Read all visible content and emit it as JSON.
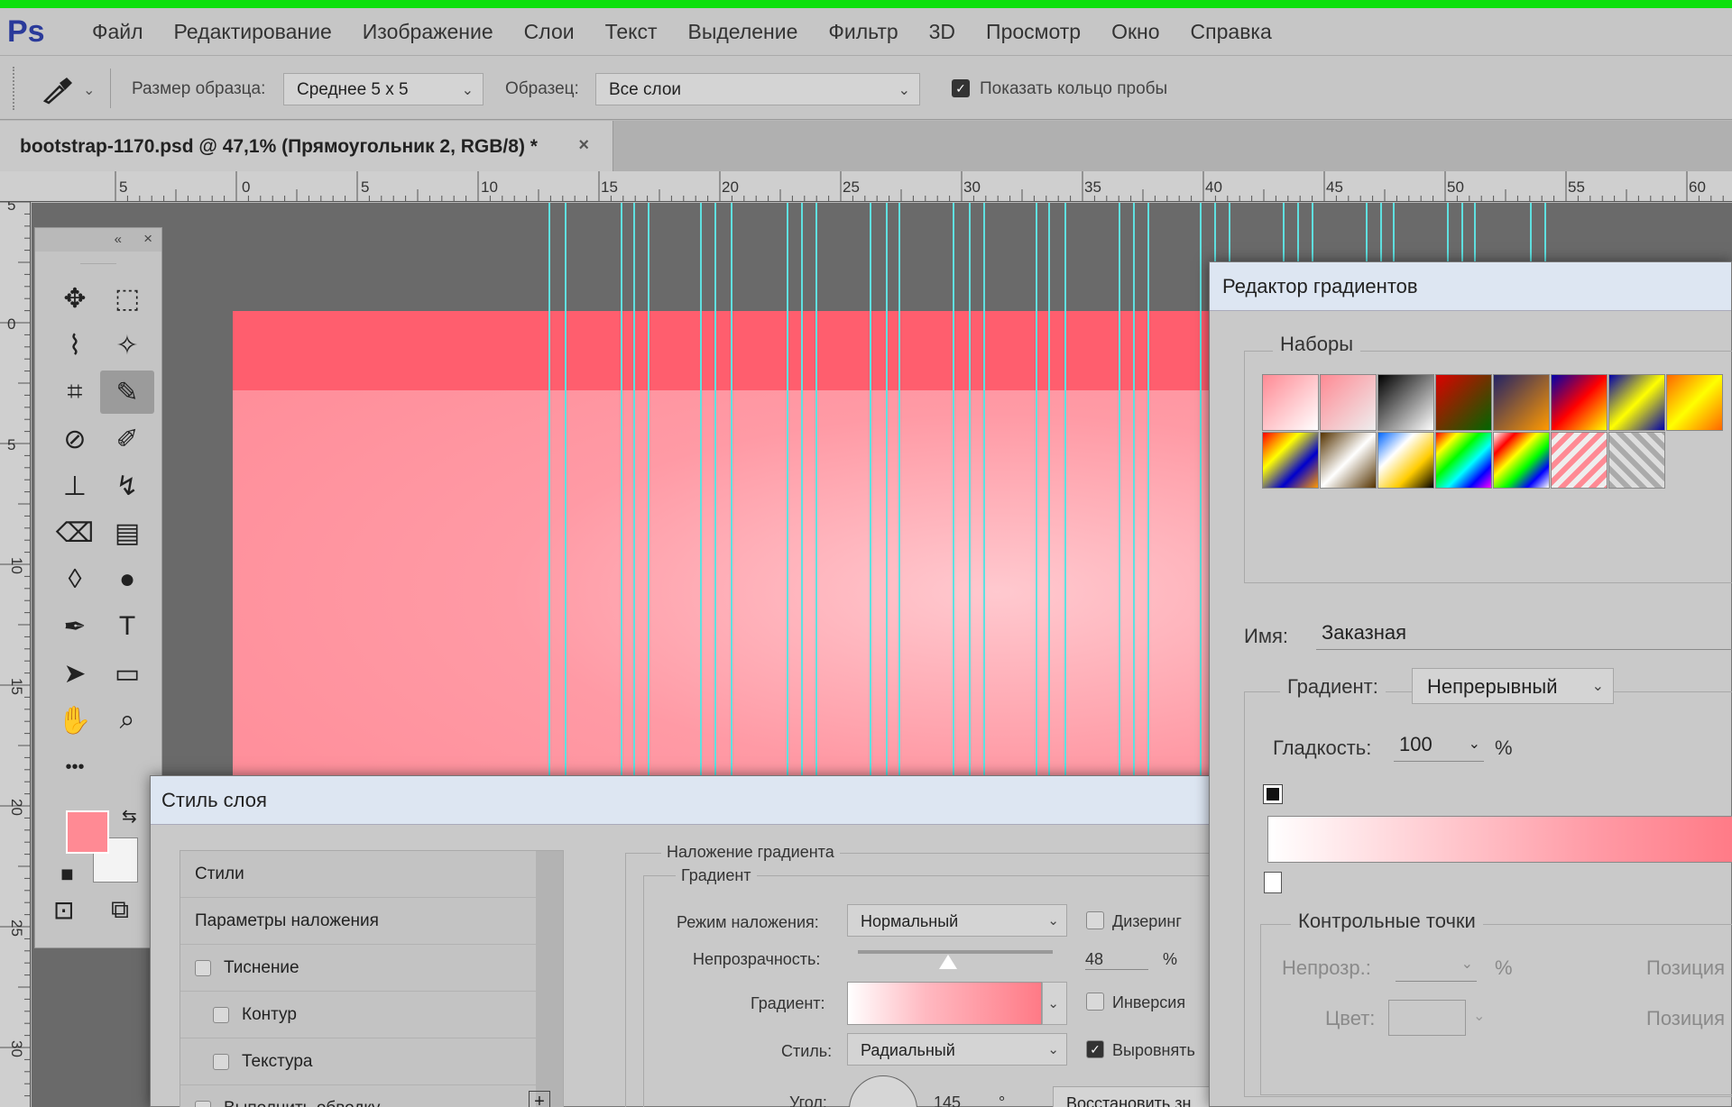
{
  "app": {
    "logo": "Ps"
  },
  "menu": [
    "Файл",
    "Редактирование",
    "Изображение",
    "Слои",
    "Текст",
    "Выделение",
    "Фильтр",
    "3D",
    "Просмотр",
    "Окно",
    "Справка"
  ],
  "options": {
    "sample_size_label": "Размер образца:",
    "sample_size_value": "Среднее 5 х 5",
    "sample_label": "Образец:",
    "sample_value": "Все слои",
    "show_ring_label": "Показать кольцо пробы",
    "show_ring_checked": true
  },
  "document_tab": {
    "title": "bootstrap-1170.psd @ 47,1% (Прямоугольник 2, RGB/8) *",
    "close": "×"
  },
  "ruler": {
    "h_labels": [
      "5",
      "0",
      "5",
      "10",
      "15",
      "20",
      "25",
      "30",
      "35",
      "40",
      "45",
      "50",
      "55",
      "60"
    ],
    "v_labels": [
      "5",
      "0",
      "5",
      "10",
      "15",
      "20",
      "25",
      "30"
    ]
  },
  "tools_panel": {
    "collapse": "«",
    "close": "×",
    "tools": [
      {
        "name": "move-tool",
        "glyph": "✥"
      },
      {
        "name": "marquee-tool",
        "glyph": "⬚"
      },
      {
        "name": "lasso-tool",
        "glyph": "⌇"
      },
      {
        "name": "magic-wand-tool",
        "glyph": "✧"
      },
      {
        "name": "crop-tool",
        "glyph": "⌗"
      },
      {
        "name": "eyedropper-tool",
        "glyph": "✎"
      },
      {
        "name": "healing-brush-tool",
        "glyph": "⊘"
      },
      {
        "name": "brush-tool",
        "glyph": "✐"
      },
      {
        "name": "stamp-tool",
        "glyph": "⊥"
      },
      {
        "name": "history-brush-tool",
        "glyph": "↯"
      },
      {
        "name": "eraser-tool",
        "glyph": "⌫"
      },
      {
        "name": "gradient-tool",
        "glyph": "▤"
      },
      {
        "name": "blur-tool",
        "glyph": "◊"
      },
      {
        "name": "dodge-tool",
        "glyph": "●"
      },
      {
        "name": "pen-tool",
        "glyph": "✒"
      },
      {
        "name": "type-tool",
        "glyph": "T"
      },
      {
        "name": "path-selection-tool",
        "glyph": "➤"
      },
      {
        "name": "rectangle-tool",
        "glyph": "▭"
      },
      {
        "name": "hand-tool",
        "glyph": "✋"
      },
      {
        "name": "zoom-tool",
        "glyph": "⌕"
      },
      {
        "name": "more-tools",
        "glyph": "•••"
      }
    ],
    "fg_color": "#ff8a94",
    "bg_color": "#f3f3f3"
  },
  "layer_style": {
    "title": "Стиль слоя",
    "rows": [
      {
        "label": "Стили",
        "checkbox": false,
        "indent": false
      },
      {
        "label": "Параметры наложения",
        "checkbox": false,
        "indent": false
      },
      {
        "label": "Тиснение",
        "checkbox": true,
        "indent": false
      },
      {
        "label": "Контур",
        "checkbox": true,
        "indent": true
      },
      {
        "label": "Текстура",
        "checkbox": true,
        "indent": true
      },
      {
        "label": "Выполнить обводку",
        "checkbox": true,
        "indent": false
      }
    ],
    "add_icon": "+",
    "section_title": "Наложение градиента",
    "subsection_title": "Градиент",
    "blend_mode_label": "Режим наложения:",
    "blend_mode_value": "Нормальный",
    "dither_label": "Дизеринг",
    "opacity_label": "Непрозрачность:",
    "opacity_value": "48",
    "opacity_unit": "%",
    "gradient_label": "Градиент:",
    "reverse_label": "Инверсия",
    "style_label": "Стиль:",
    "style_value": "Радиальный",
    "align_label": "Выровнять",
    "angle_label": "Угол:",
    "angle_value": "145",
    "angle_unit": "°",
    "reset_label": "Восстановить зн"
  },
  "gradient_editor": {
    "title": "Редактор градиентов",
    "presets_label": "Наборы",
    "name_label": "Имя:",
    "name_value": "Заказная",
    "gradient_type_label": "Градиент:",
    "gradient_type_value": "Непрерывный",
    "smoothness_label": "Гладкость:",
    "smoothness_value": "100",
    "smoothness_unit": "%",
    "stops_label": "Контрольные точки",
    "opacity_label": "Непрозр.:",
    "opacity_unit": "%",
    "color_label": "Цвет:",
    "position_label": "Позиция",
    "presets": [
      "linear-gradient(135deg,#ff8a94,#fff)",
      "linear-gradient(135deg,#ff8a94,#eee)",
      "linear-gradient(135deg,#000,#fff)",
      "linear-gradient(135deg,#d00,#060)",
      "linear-gradient(135deg,#226,#f90)",
      "linear-gradient(135deg,#00a,#f00,#ff0)",
      "linear-gradient(135deg,#00a,#ff0,#00a)",
      "linear-gradient(135deg,#f60,#ff0,#f60)",
      "linear-gradient(135deg,#f00,#ff0,#00c,#f90)",
      "linear-gradient(135deg,#530,#fff,#530)",
      "linear-gradient(135deg,#06f,#fff,#fc0,#000)",
      "linear-gradient(135deg,#f00,#ff0,#0f0,#0ff,#00f,#f0f)",
      "linear-gradient(135deg,#fff,#f00,#ff0,#0f0,#00f,#fff)",
      "repeating-linear-gradient(135deg,#ff8a94 0 6px,#eee 6px 12px)",
      "repeating-linear-gradient(45deg,#aaa 0 6px,#ddd 6px 12px)"
    ]
  }
}
